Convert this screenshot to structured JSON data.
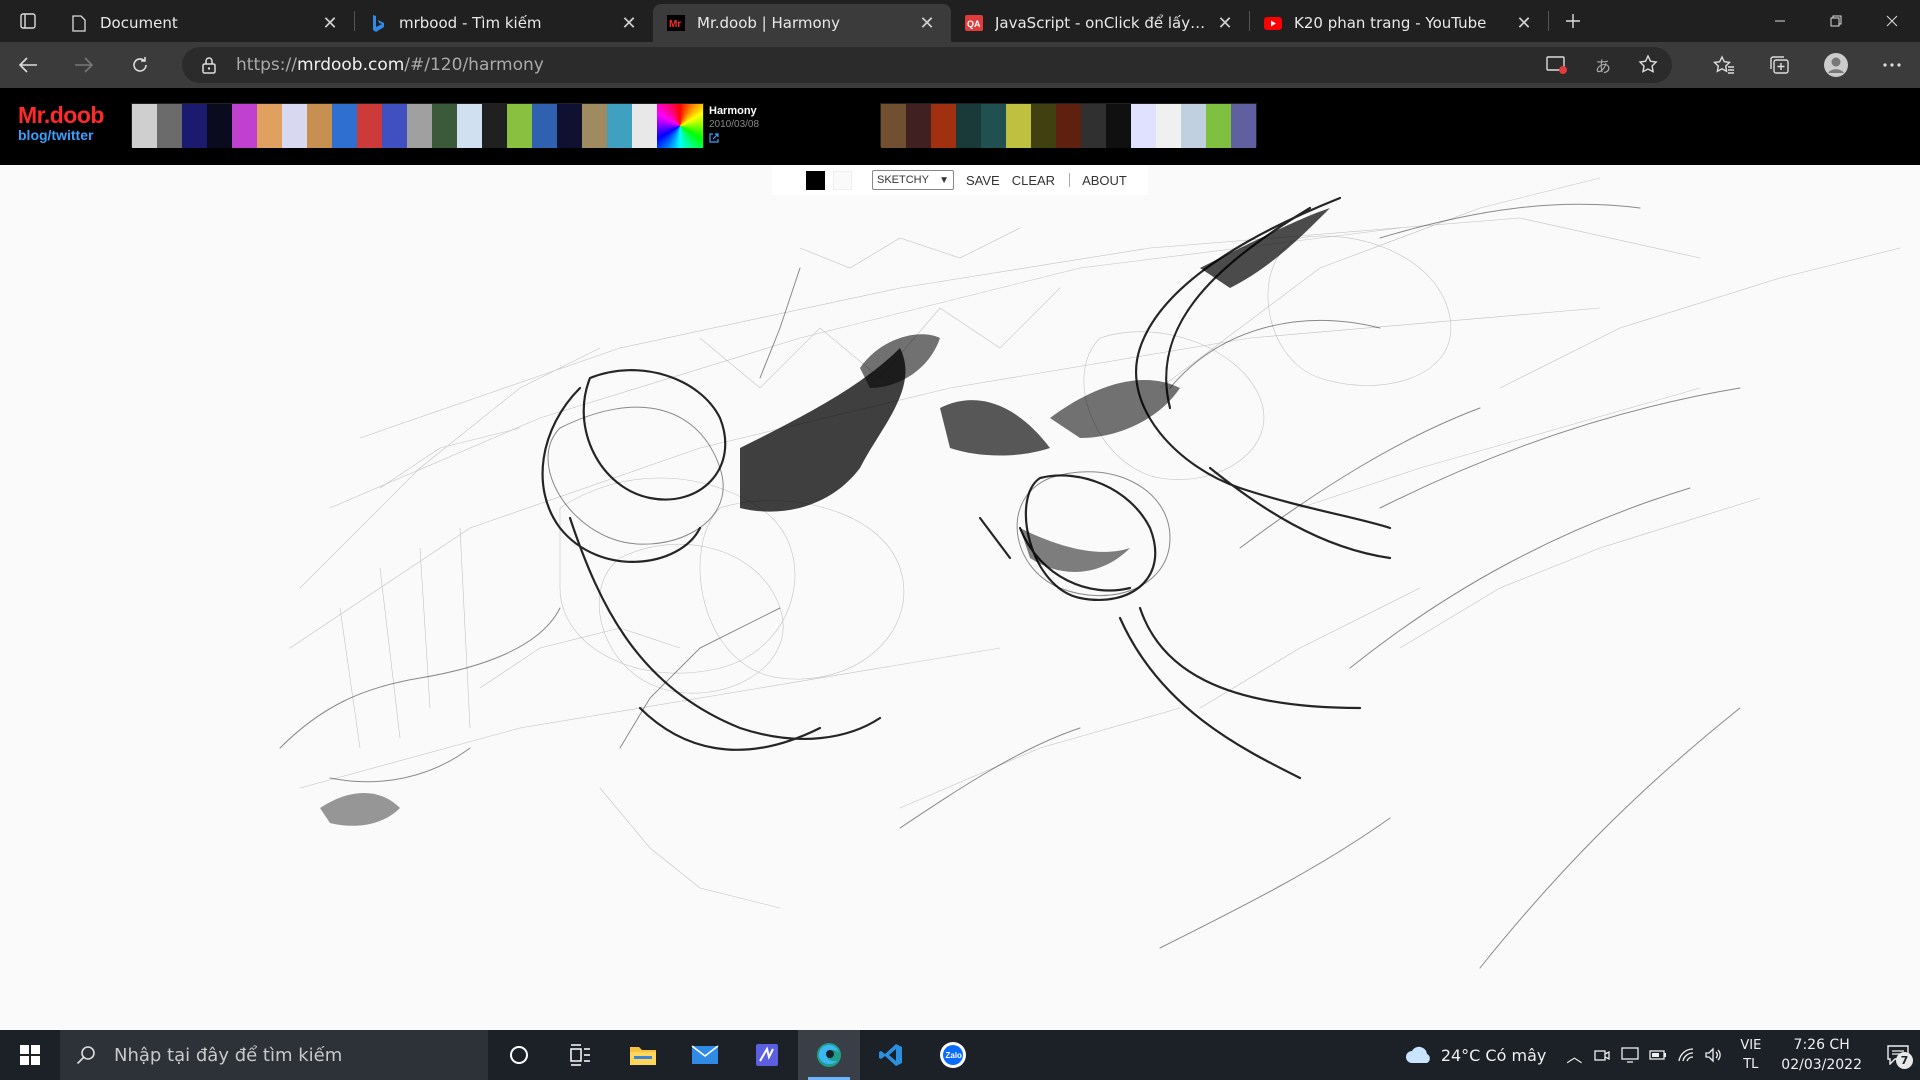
{
  "browser": {
    "tabs": [
      {
        "title": "Document",
        "icon": "document-icon",
        "active": false
      },
      {
        "title": "mrbood - Tìm kiếm",
        "icon": "bing-icon",
        "active": false
      },
      {
        "title": "Mr.doob | Harmony",
        "icon": "mrdoob-icon",
        "active": true
      },
      {
        "title": "JavaScript - onClick để lấy ID của",
        "icon": "qa-icon",
        "active": false
      },
      {
        "title": "K20 phan trang - YouTube",
        "icon": "youtube-icon",
        "active": false
      }
    ],
    "url_prefix": "https://",
    "url_host": "mrdoob.com",
    "url_path": "/#/120/harmony"
  },
  "site": {
    "logo": "Mr.doob",
    "links": "blog/twitter",
    "feature_name": "Harmony",
    "feature_date": "2010/03/08",
    "thumbnail_colors": [
      "#cfcfcf",
      "#6b6b6b",
      "#1a1a6e",
      "#0b0b1f",
      "#c040d0",
      "#e0a060",
      "#d8d8f0",
      "#c89050",
      "#2f6fd0",
      "#cc3a3a",
      "#4050c0",
      "#a0a0a0",
      "#3a5a3a",
      "#d0e0f0",
      "#202020",
      "#8ac040",
      "#3060b0",
      "#101030",
      "#a08a60",
      "#40a0c0",
      "#e8e8e8",
      "#ffffff",
      "#705030",
      "#402020",
      "#a03010",
      "#1a3a3a",
      "#205050",
      "#c0c040",
      "#404010",
      "#602010",
      "#303030",
      "#101010",
      "#e0e0ff",
      "#f0f0f0",
      "#c0d0e0",
      "#80c040",
      "#6060a0"
    ]
  },
  "toolbar": {
    "brush": "SKETCHY",
    "save": "SAVE",
    "clear": "CLEAR",
    "about": "ABOUT",
    "foreground_color": "#000000",
    "background_color": "#fafafa"
  },
  "taskbar": {
    "search_placeholder": "Nhập tại đây để tìm kiếm",
    "weather": "24°C  Có mây",
    "lang_top": "VIE",
    "lang_bottom": "TL",
    "time": "7:26 CH",
    "date": "02/03/2022",
    "notifications": "7",
    "apps": [
      "cortana-icon",
      "task-view-icon",
      "file-explorer-icon",
      "mail-icon",
      "sticky-app-icon",
      "edge-icon",
      "vscode-icon",
      "zalo-icon"
    ]
  }
}
